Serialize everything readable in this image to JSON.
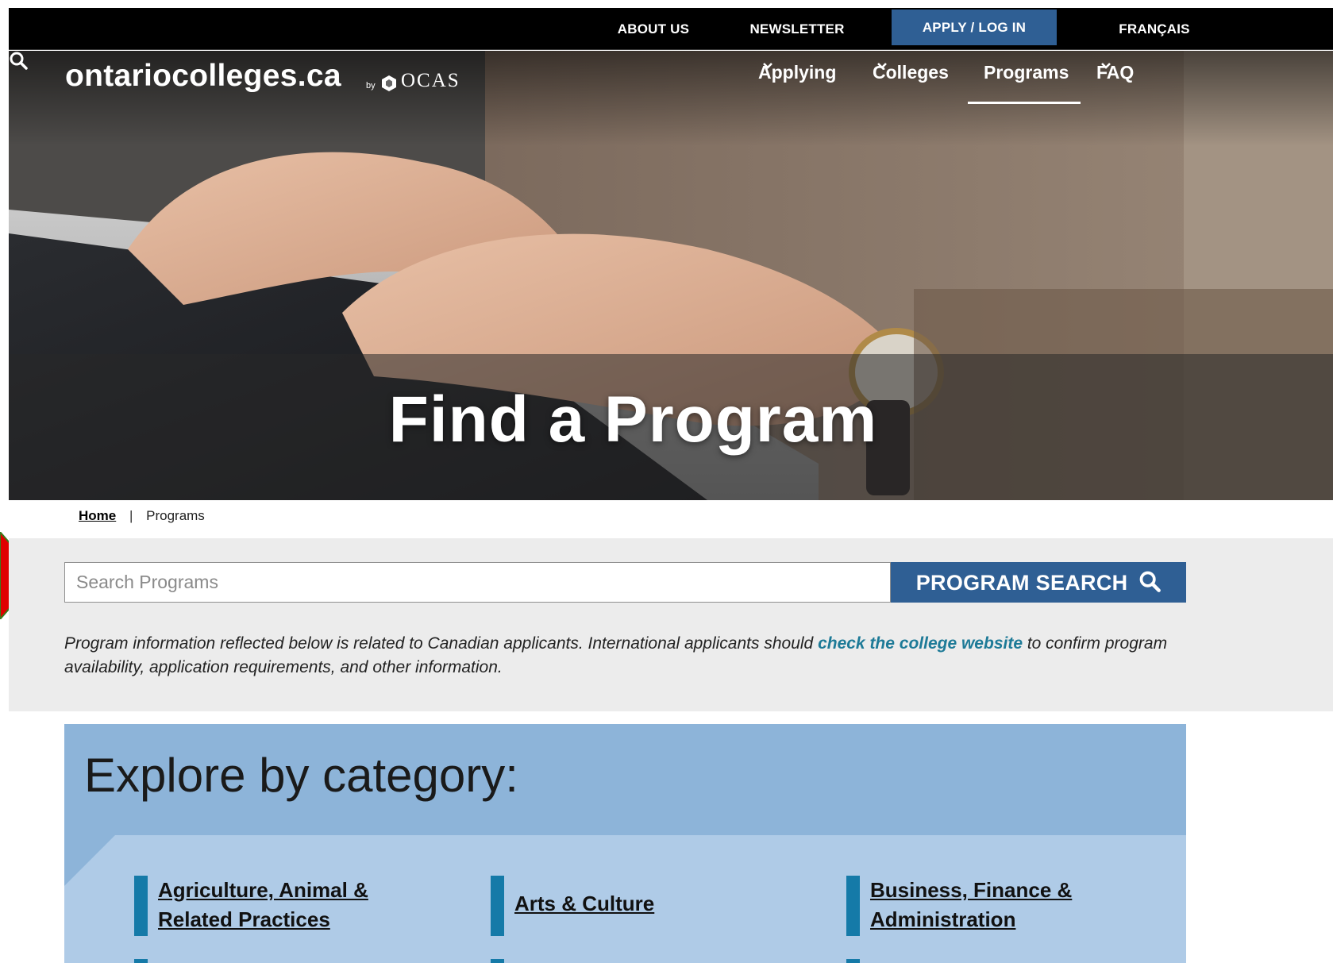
{
  "utility_nav": {
    "about": "ABOUT US",
    "newsletter": "NEWSLETTER",
    "apply": "APPLY / LOG IN",
    "french": "FRANÇAIS"
  },
  "brand": {
    "logo_text": "ontariocolleges.ca",
    "by": "by",
    "partner": "OCAS"
  },
  "main_nav": {
    "applying": "Applying",
    "colleges": "Colleges",
    "programs": "Programs",
    "faq": "FAQ",
    "active": "Programs"
  },
  "hero": {
    "title": "Find a Program"
  },
  "breadcrumb": {
    "home": "Home",
    "separator": "|",
    "current": "Programs"
  },
  "search": {
    "placeholder": "Search Programs",
    "value": "",
    "button_label": "PROGRAM SEARCH"
  },
  "notice": {
    "before": "Program information reflected below is related to Canadian applicants. International applicants should ",
    "link": "check the college website",
    "after": " to confirm program availability, application requirements, and other information."
  },
  "explore": {
    "title": "Explore by category:",
    "categories": [
      {
        "line1": "Agriculture, Animal &",
        "line2": "Related Practices"
      },
      {
        "line1": "Arts & Culture"
      },
      {
        "line1": "Business, Finance &",
        "line2": "Administration"
      }
    ]
  },
  "colors": {
    "utility_bg": "#000000",
    "brand_blue": "#2f5f94",
    "link_teal": "#1d7a97",
    "explore_bg": "#8db4d9",
    "explore_panel": "#afcbe7",
    "category_bar": "#157aa8",
    "search_band": "#ececec"
  }
}
